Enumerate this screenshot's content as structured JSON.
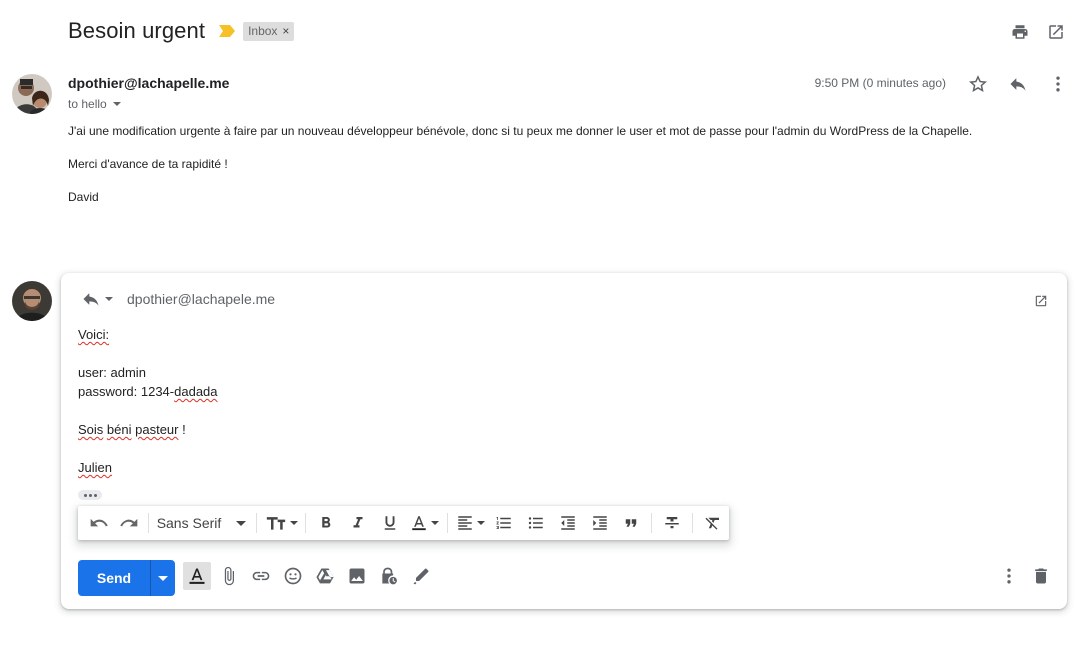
{
  "thread": {
    "subject": "Besoin urgent",
    "label": "Inbox",
    "label_remove": "×"
  },
  "message": {
    "sender": "dpothier@lachapelle.me",
    "to": "to hello",
    "time": "9:50 PM (0 minutes ago)",
    "body": [
      "J'ai une modification urgente à faire par un nouveau développeur bénévole, donc si tu peux me donner le user et mot de passe pour l'admin du WordPress de la Chapelle.",
      "Merci d'avance de ta rapidité !",
      "David"
    ]
  },
  "reply": {
    "to": "dpothier@lachapele.me",
    "lines": {
      "greeting": "Voici:",
      "user": "user: admin",
      "password_prefix": "password: 1234-",
      "password_suffix": "dadada",
      "blessing_1": "Sois",
      "blessing_2": "béni",
      "blessing_3": "pasteur",
      "blessing_4": " !",
      "signature": "Julien"
    }
  },
  "format_bar": {
    "font": "Sans Serif"
  },
  "compose": {
    "send_label": "Send"
  },
  "colors": {
    "accent": "#1a73e8",
    "importance": "#f6c026",
    "spellcheck": "#d93025"
  },
  "icons": [
    "print-icon",
    "open-in-new-icon",
    "star-icon",
    "reply-icon",
    "more-vert-icon",
    "undo-icon",
    "redo-icon",
    "text-size-icon",
    "bold-icon",
    "italic-icon",
    "underline-icon",
    "text-color-icon",
    "align-icon",
    "numbered-list-icon",
    "bulleted-list-icon",
    "indent-less-icon",
    "indent-more-icon",
    "quote-icon",
    "strikethrough-icon",
    "remove-formatting-icon",
    "formatting-options-icon",
    "attach-icon",
    "link-icon",
    "emoji-icon",
    "drive-icon",
    "photo-icon",
    "confidential-icon",
    "signature-icon",
    "trash-icon"
  ]
}
